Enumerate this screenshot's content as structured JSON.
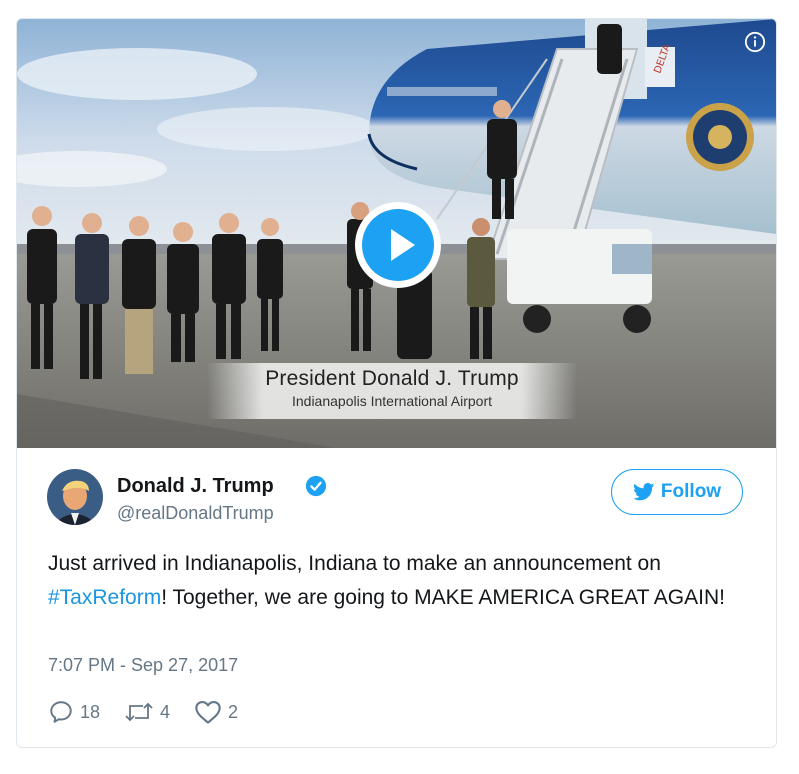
{
  "media": {
    "caption_title": "President Donald J. Trump",
    "caption_subtitle": "Indianapolis International Airport",
    "plane_tail_text": "DELTA",
    "play_icon": "play-icon",
    "info_icon": "info-icon"
  },
  "author": {
    "name": "Donald J. Trump",
    "handle": "@realDonaldTrump",
    "verified_icon": "verified-badge-icon"
  },
  "follow_button": {
    "label": "Follow",
    "icon": "twitter-bird-icon"
  },
  "tweet": {
    "text_before": "Just arrived in Indianapolis, Indiana to make an announcement on ",
    "hashtag": "#TaxReform",
    "text_after": "! Together, we are going to MAKE AMERICA GREAT AGAIN!",
    "timestamp": "7:07 PM - Sep 27, 2017"
  },
  "stats": {
    "replies": "18",
    "retweets": "4",
    "likes": "2"
  },
  "colors": {
    "accent": "#1da1f2",
    "hashtag": "#1b95e0",
    "muted": "#657786",
    "border": "#e1e8ed"
  }
}
